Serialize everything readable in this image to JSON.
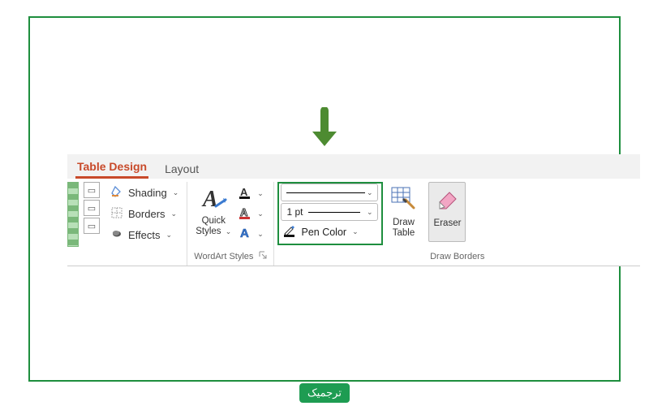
{
  "tabs": {
    "active": "Table Design",
    "other": "Layout"
  },
  "tablestyles": {
    "shading": "Shading",
    "borders": "Borders",
    "effects": "Effects"
  },
  "wordart": {
    "quick": "Quick",
    "styles": "Styles",
    "group_label": "WordArt Styles"
  },
  "drawborders": {
    "pen_weight": "1 pt",
    "pen_color": "Pen Color",
    "draw": "Draw",
    "table": "Table",
    "eraser": "Eraser",
    "group_label": "Draw Borders"
  },
  "badge": "ترجمیک"
}
